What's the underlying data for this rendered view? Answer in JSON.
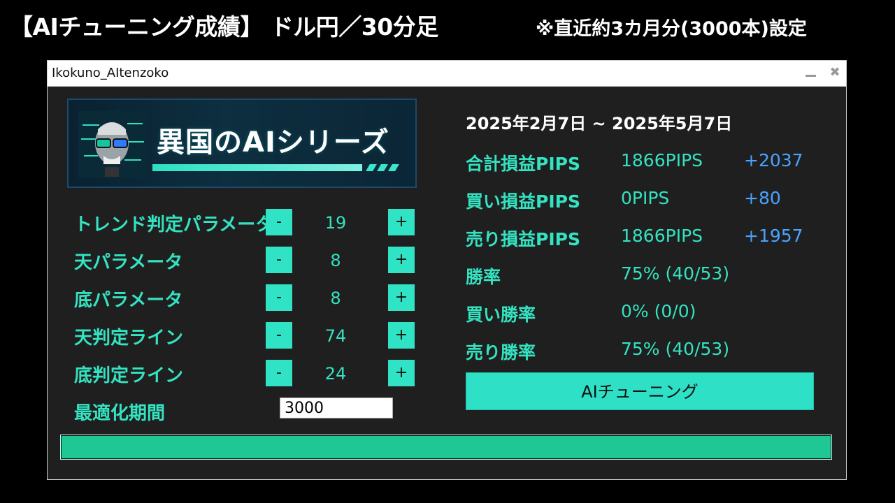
{
  "headline": {
    "main": "【AIチューニング成績】 ドル円／30分足",
    "sub": "※直近約3カ月分(3000本)設定"
  },
  "window": {
    "title": "Ikokuno_AItenzoko",
    "minimize_glyph": "_",
    "close_glyph": "✖"
  },
  "banner": {
    "title": "異国のAIシリーズ",
    "icon": "robot-face-icon"
  },
  "params": [
    {
      "label": "トレンド判定パラメータ",
      "minus": "-",
      "value": "19",
      "plus": "+"
    },
    {
      "label": "天パラメータ",
      "minus": "-",
      "value": "8",
      "plus": "+"
    },
    {
      "label": "底パラメータ",
      "minus": "-",
      "value": "8",
      "plus": "+"
    },
    {
      "label": "天判定ライン",
      "minus": "-",
      "value": "74",
      "plus": "+"
    },
    {
      "label": "底判定ライン",
      "minus": "-",
      "value": "24",
      "plus": "+"
    }
  ],
  "optimization": {
    "label": "最適化期間",
    "value": "3000"
  },
  "stats": {
    "date_range": "2025年2月7日 ~ 2025年5月7日",
    "rows": [
      {
        "label": "合計損益PIPS",
        "value": "1866PIPS",
        "delta": "+2037"
      },
      {
        "label": "買い損益PIPS",
        "value": "0PIPS",
        "delta": "+80"
      },
      {
        "label": "売り損益PIPS",
        "value": "1866PIPS",
        "delta": "+1957"
      },
      {
        "label": "勝率",
        "value": "75% (40/53)",
        "delta": ""
      },
      {
        "label": "買い勝率",
        "value": "0% (0/0)",
        "delta": ""
      },
      {
        "label": "売り勝率",
        "value": "75% (40/53)",
        "delta": ""
      }
    ]
  },
  "tune_button": "AIチューニング",
  "progress": {
    "fraction": 1.0
  },
  "colors": {
    "accent": "#2fe3c4",
    "delta": "#4aa3ff",
    "progress": "#1fc794",
    "panel": "#1f1f1f"
  }
}
